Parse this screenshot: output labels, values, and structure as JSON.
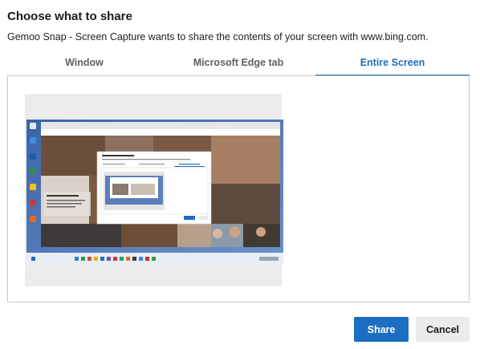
{
  "dialog": {
    "title": "Choose what to share",
    "subtitle": "Gemoo Snap - Screen Capture wants to share the contents of your screen with www.bing.com."
  },
  "tabs": [
    {
      "label": "Window",
      "active": false
    },
    {
      "label": "Microsoft Edge tab",
      "active": false
    },
    {
      "label": "Entire Screen",
      "active": true
    }
  ],
  "preview": {
    "selected": false,
    "inner_brand": "Microsoft Bing",
    "inner_dialog_title": "Choose what to share"
  },
  "buttons": {
    "share_label": "Share",
    "cancel_label": "Cancel"
  },
  "colors": {
    "accent": "#1b6ec2",
    "active_tab": "#1f6fb8",
    "desktop_bg": "#4a6fa0"
  }
}
